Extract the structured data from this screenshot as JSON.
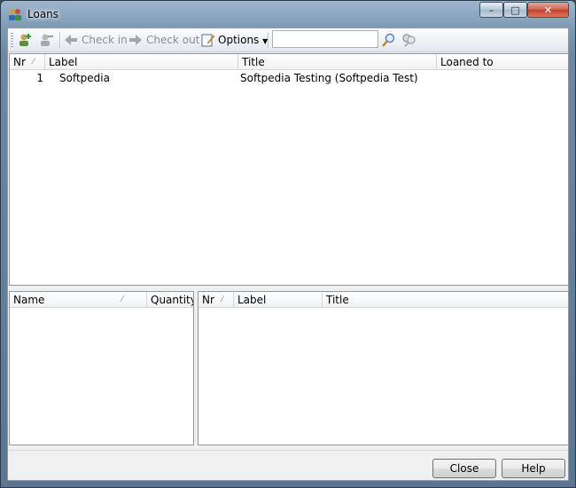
{
  "window": {
    "title": "Loans"
  },
  "title_controls": {
    "minimize": "–",
    "maximize": "□",
    "close": "✕"
  },
  "toolbar": {
    "check_in": "Check in",
    "check_out": "Check out",
    "options": "Options",
    "search_value": ""
  },
  "loans_table": {
    "columns": [
      "Nr",
      "Label",
      "Title",
      "Loaned to"
    ],
    "rows": [
      {
        "nr": "1",
        "label": "Softpedia",
        "title": "Softpedia Testing (Softpedia Test)",
        "loaned_to": ""
      }
    ]
  },
  "left_table": {
    "columns": [
      "Name",
      "Quantity"
    ]
  },
  "right_table": {
    "columns": [
      "Nr",
      "Label",
      "Title"
    ]
  },
  "buttons": {
    "close": "Close",
    "help": "Help"
  }
}
